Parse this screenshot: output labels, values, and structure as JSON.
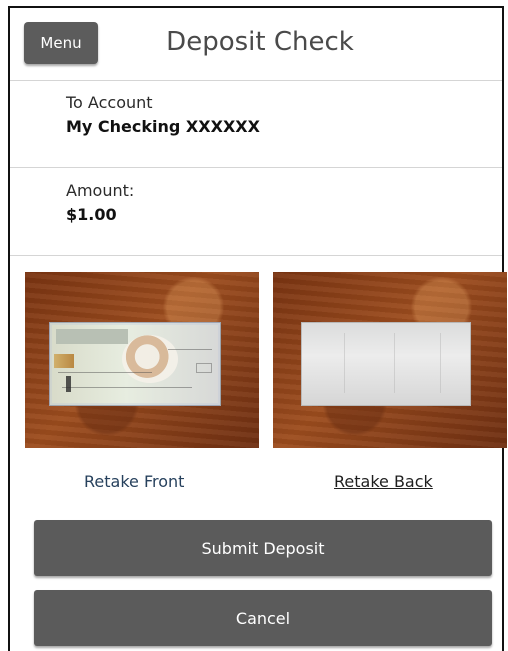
{
  "header": {
    "menu_label": "Menu",
    "title": "Deposit Check"
  },
  "account": {
    "label": "To Account",
    "value": "My Checking XXXXXX"
  },
  "amount": {
    "label": "Amount:",
    "value": "$1.00"
  },
  "actions": {
    "retake_front": "Retake Front",
    "retake_back": "Retake Back",
    "submit": "Submit Deposit",
    "cancel": "Cancel"
  },
  "colors": {
    "button_bg": "#5b5b5b",
    "button_text": "#ffffff",
    "link_blue": "#27415d",
    "divider": "#d5d5d5"
  },
  "images": {
    "front": "check-front-image",
    "back": "check-back-image"
  }
}
